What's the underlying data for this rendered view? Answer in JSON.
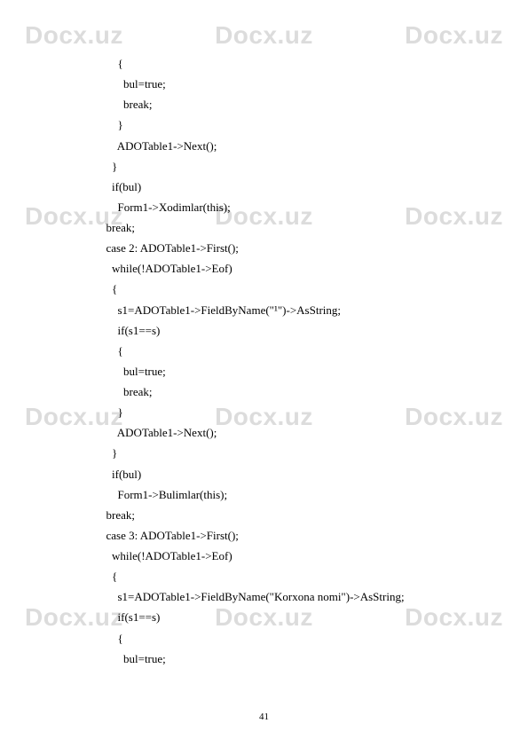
{
  "watermark": "Docx.uz",
  "page_number": "41",
  "code_lines": [
    "          {",
    "            bul=true;",
    "            break;",
    "          }",
    "          ADOTable1->Next();",
    "        }",
    "        if(bul)",
    "          Form1->Xodimlar(this);",
    "      break;",
    "      case 2: ADOTable1->First();",
    "        while(!ADOTable1->Eof)",
    "        {",
    "          s1=ADOTable1->FieldByName(\"¹\")->AsString;",
    "          if(s1==s)",
    "          {",
    "            bul=true;",
    "            break;",
    "          }",
    "          ADOTable1->Next();",
    "        }",
    "        if(bul)",
    "          Form1->Bulimlar(this);",
    "      break;",
    "      case 3: ADOTable1->First();",
    "        while(!ADOTable1->Eof)",
    "        {",
    "          s1=ADOTable1->FieldByName(\"Korxona nomi\")->AsString;",
    "          if(s1==s)",
    "          {",
    "            bul=true;"
  ]
}
